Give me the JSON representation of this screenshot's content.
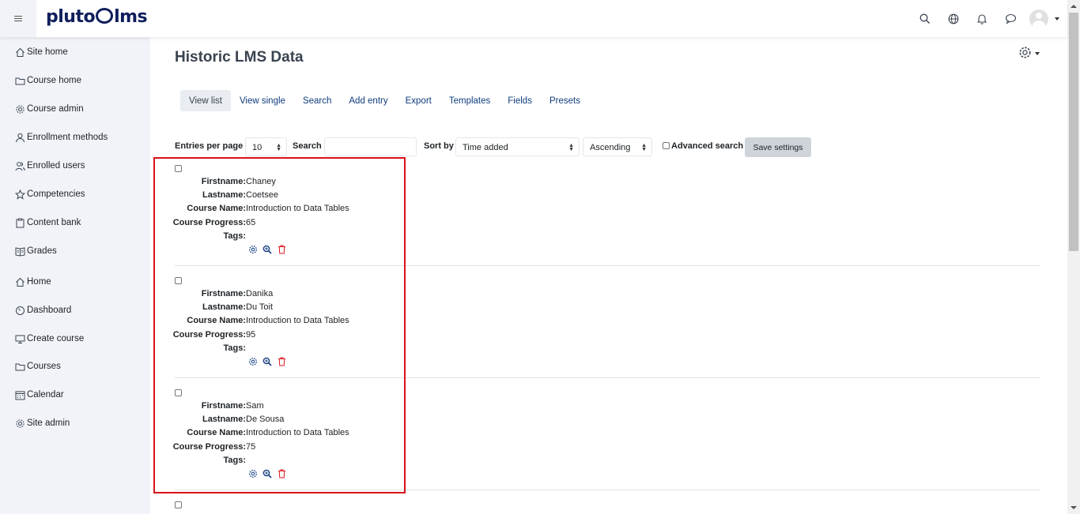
{
  "brand": {
    "logo_text_left": "pluto",
    "logo_text_right": "lms"
  },
  "sidebar": {
    "items": [
      {
        "label": "Site home",
        "icon": "home-icon"
      },
      {
        "label": "Course home",
        "icon": "folder-icon"
      },
      {
        "label": "Course admin",
        "icon": "gear-icon"
      },
      {
        "label": "Enrollment methods",
        "icon": "user-icon"
      },
      {
        "label": "Enrolled users",
        "icon": "users-icon"
      },
      {
        "label": "Competencies",
        "icon": "star-icon"
      },
      {
        "label": "Content bank",
        "icon": "clipboard-icon"
      },
      {
        "label": "Grades",
        "icon": "book-icon"
      },
      {
        "label": "Home",
        "icon": "home-icon"
      },
      {
        "label": "Dashboard",
        "icon": "gauge-icon"
      },
      {
        "label": "Create course",
        "icon": "monitor-icon"
      },
      {
        "label": "Courses",
        "icon": "folder-icon"
      },
      {
        "label": "Calendar",
        "icon": "calendar-icon"
      },
      {
        "label": "Site admin",
        "icon": "gear-icon"
      }
    ]
  },
  "page": {
    "title": "Historic LMS Data"
  },
  "tabs": [
    "View list",
    "View single",
    "Search",
    "Add entry",
    "Export",
    "Templates",
    "Fields",
    "Presets"
  ],
  "filters": {
    "entries_label": "Entries per page",
    "entries_value": "10",
    "search_label": "Search",
    "search_value": "",
    "sort_label": "Sort by",
    "sort_value": "Time added",
    "order_value": "Ascending",
    "advanced_label": "Advanced search",
    "save_label": "Save settings"
  },
  "field_labels": {
    "firstname": "Firstname:",
    "lastname": "Lastname:",
    "course": "Course Name:",
    "progress": "Course Progress:",
    "tags": "Tags:"
  },
  "entries": [
    {
      "firstname": "Chaney",
      "lastname": "Coetsee",
      "course": "Introduction to Data Tables",
      "progress": "65"
    },
    {
      "firstname": "Danika",
      "lastname": "Du Toit",
      "course": "Introduction to Data Tables",
      "progress": "95"
    },
    {
      "firstname": "Sam",
      "lastname": "De Sousa",
      "course": "Introduction to Data Tables",
      "progress": "75"
    }
  ],
  "colors": {
    "accent": "#0f3c7c",
    "brand": "#0f1e5c",
    "delete": "#d9111a",
    "highlight": "#d9111a"
  }
}
